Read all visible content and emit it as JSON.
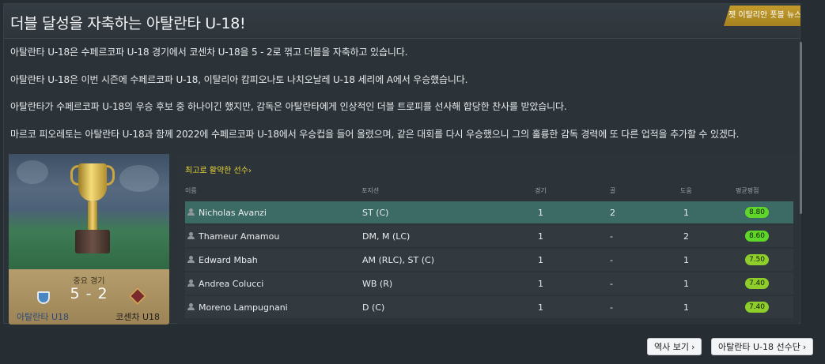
{
  "article": {
    "title": "더블 달성을 자축하는 아탈란타 U-18!",
    "source_tag": "젯 이탈리안 풋볼 뉴스",
    "paragraphs": [
      "아탈란타 U-18은 수페르코파 U-18 경기에서 코센차 U-18을 5 - 2로 꺾고 더블을 자축하고 있습니다.",
      "아탈란타 U-18은 이번 시즌에 수페르코파 U-18, 이탈리아 캄피오나토 나치오날레 U-18 세리에 A에서 우승했습니다.",
      "아탈란타가 수페르코파 U-18의 우승 후보 중 하나이긴 했지만,  감독은 아탈란타에게 인상적인 더블 트로피를 선사해 합당한 찬사를 받았습니다.",
      "마르코  피오레토는 아탈란타 U-18과 함께 2022에 수페르코파 U-18에서 우승컵을 들어 올렸으며, 같은 대회를 다시 우승했으니 그의 훌륭한 감독 경력에 또 다른 업적을 추가할 수 있겠다."
    ]
  },
  "match": {
    "label": "중요 경기",
    "score": "5 - 2",
    "home_team": "아탈란타 U18",
    "away_team": "코센차 U18"
  },
  "players": {
    "header": "최고로 활약한 선수",
    "header_chevron": "›",
    "columns": {
      "name": "이름",
      "position": "포지션",
      "apps": "경기",
      "goals": "골",
      "assists": "도움",
      "rating": "평균평점"
    },
    "rows": [
      {
        "name": "Nicholas Avanzi",
        "position": "ST (C)",
        "apps": "1",
        "goals": "2",
        "assists": "1",
        "rating": "8.80"
      },
      {
        "name": "Thameur Amamou",
        "position": "DM, M (LC)",
        "apps": "1",
        "goals": "-",
        "assists": "2",
        "rating": "8.60"
      },
      {
        "name": "Edward Mbah",
        "position": "AM (RLC), ST (C)",
        "apps": "1",
        "goals": "-",
        "assists": "1",
        "rating": "7.50"
      },
      {
        "name": "Andrea Colucci",
        "position": "WB (R)",
        "apps": "1",
        "goals": "-",
        "assists": "1",
        "rating": "7.40"
      },
      {
        "name": "Moreno Lampugnani",
        "position": "D (C)",
        "apps": "1",
        "goals": "-",
        "assists": "1",
        "rating": "7.40"
      }
    ]
  },
  "buttons": {
    "history": "역사 보기",
    "squad": "아탈란타 U-18 선수단",
    "chevron": "›"
  },
  "colors": {
    "accent_gold": "#c39b2c",
    "selected_row": "#3c6b66",
    "rating_high": "#5fd62a",
    "rating_mid": "#8fcd2a",
    "header_yellow": "#e7d238"
  }
}
